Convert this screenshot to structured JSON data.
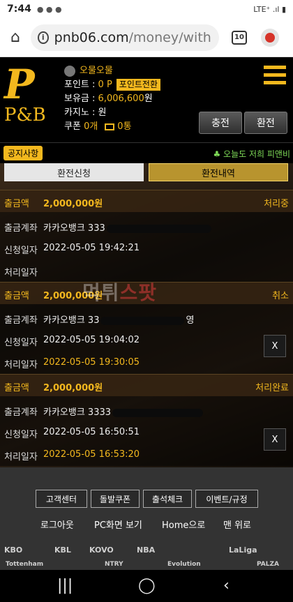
{
  "status_bar": {
    "time": "7:44",
    "notif_icons": "● ● ●",
    "signal": "LTE⁺ .ıl ▮"
  },
  "browser": {
    "url_host": "pnb06.com",
    "url_path": "/money/withdraw",
    "tab_count": "10"
  },
  "header": {
    "logo_brand": "P&B",
    "username": "오물오물",
    "points_label": "포인트 :",
    "points_value": "0 P",
    "points_convert_btn": "포인트전환",
    "balance_label": "보유금 :",
    "balance_value": "6,006,600",
    "balance_unit": "원",
    "casino_label": "카지노 :",
    "casino_value": "원",
    "coupon_label": "쿠폰",
    "coupon_value": "0개",
    "mail_value": "0통",
    "charge_btn": "충전",
    "exchange_btn": "환전"
  },
  "notice": {
    "tag": "공지사항",
    "text": "♣ 오늘도 저희 피앤비"
  },
  "tabs": {
    "request": "환전신청",
    "history": "환전내역"
  },
  "labels": {
    "amount": "출금액",
    "account": "출금계좌",
    "request_date": "신청일자",
    "process_date": "처리일자"
  },
  "records": [
    {
      "amount": "2,000,000원",
      "status": "처리중",
      "account": "카카오뱅크 333",
      "request_date": "2022-05-05 19:42:21",
      "process_date": ""
    },
    {
      "amount": "2,000,000원",
      "status": "취소",
      "account": "카카오뱅크 33",
      "account_tail": "영",
      "request_date": "2022-05-05 19:04:02",
      "process_date": "2022-05-05 19:30:05",
      "close": "X"
    },
    {
      "amount": "2,000,000원",
      "status": "처리완료",
      "account": "카카오뱅크 3333",
      "request_date": "2022-05-05 16:50:51",
      "process_date": "2022-05-05 16:53:20",
      "close": "X"
    }
  ],
  "watermark": {
    "main": "먹튀",
    "accent": "스팟"
  },
  "footer": {
    "buttons": [
      "고객센터",
      "돌발쿠폰",
      "출석체크",
      "이벤트/규정"
    ],
    "links": [
      "로그아웃",
      "PC화면 보기",
      "Home으로",
      "맨 위로"
    ],
    "partner_logos": [
      "KBO",
      "KBL",
      "KOVO",
      "NBA",
      "LaLiga",
      "Tottenham",
      "NTRY",
      "Evolution",
      "PALZA"
    ]
  },
  "colors": {
    "accent": "#f3b81e",
    "background": "#000000",
    "footer": "#333333"
  }
}
